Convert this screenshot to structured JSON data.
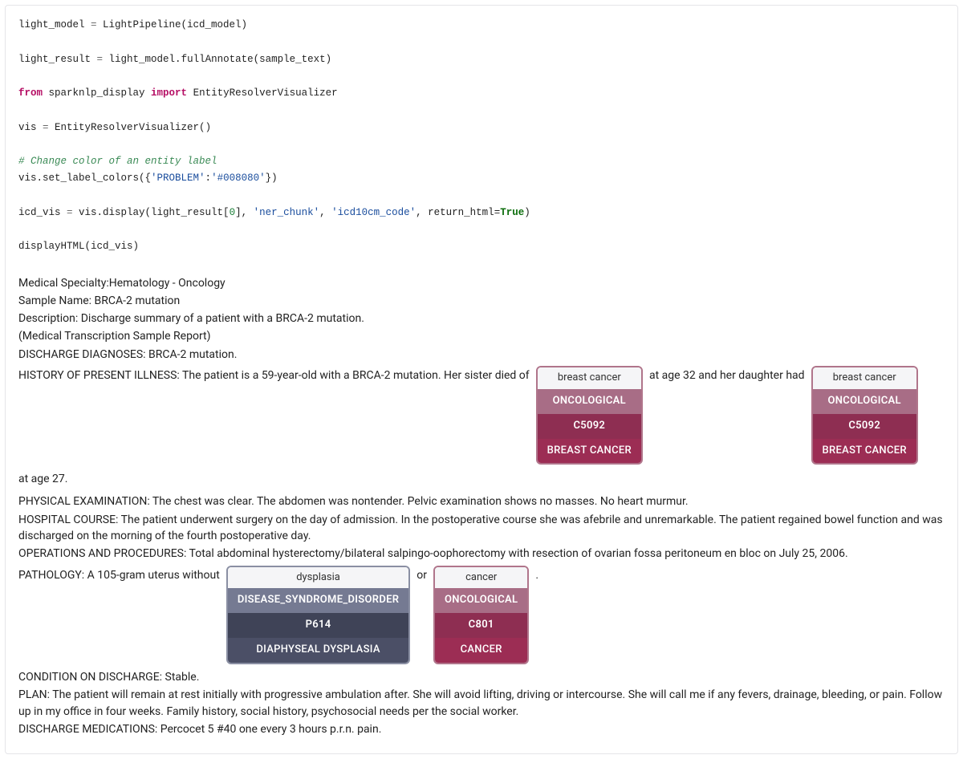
{
  "code": {
    "l1a": "light_model ",
    "l1b": "=",
    "l1c": " LightPipeline(icd_model)",
    "l2a": "light_result ",
    "l2b": "=",
    "l2c": " light_model.fullAnnotate(sample_text)",
    "l3a": "from",
    "l3b": " sparknlp_display ",
    "l3c": "import",
    "l3d": " EntityResolverVisualizer",
    "l4a": "vis ",
    "l4b": "=",
    "l4c": " EntityResolverVisualizer()",
    "l5": "# Change color of an entity label",
    "l6a": "vis.set_label_colors({",
    "l6b": "'PROBLEM'",
    "l6c": ":",
    "l6d": "'#008080'",
    "l6e": "})",
    "l7a": "icd_vis ",
    "l7b": "=",
    "l7c": " vis.display(light_result[",
    "l7d": "0",
    "l7e": "], ",
    "l7f": "'ner_chunk'",
    "l7g": ", ",
    "l7h": "'icd10cm_code'",
    "l7i": ", return_html=",
    "l7j": "True",
    "l7k": ")",
    "l8": "displayHTML(icd_vis)"
  },
  "doc": {
    "meta": [
      "Medical Specialty:Hematology - Oncology",
      "Sample Name: BRCA-2 mutation",
      "Description: Discharge summary of a patient with a BRCA-2 mutation.",
      "(Medical Transcription Sample Report)",
      "DISCHARGE DIAGNOSES: BRCA-2 mutation."
    ],
    "history_pre": "HISTORY OF PRESENT ILLNESS: The patient is a 59-year-old with a BRCA-2 mutation. Her sister died of",
    "history_mid": "at age 32 and her daughter had",
    "history_post": "at age 27.",
    "ent_bc": {
      "text": "breast cancer",
      "label": "ONCOLOGICAL",
      "code": "C5092",
      "res": "BREAST CANCER"
    },
    "pe": "PHYSICAL EXAMINATION: The chest was clear. The abdomen was nontender. Pelvic examination shows no masses. No heart murmur.",
    "hc": "HOSPITAL COURSE: The patient underwent surgery on the day of admission. In the postoperative course she was afebrile and unremarkable. The patient regained bowel function and was discharged on the morning of the fourth postoperative day.",
    "op": "OPERATIONS AND PROCEDURES: Total abdominal hysterectomy/bilateral salpingo-oophorectomy with resection of ovarian fossa peritoneum en bloc on July 25, 2006.",
    "path_pre": "PATHOLOGY: A 105-gram uterus without",
    "path_mid": "or",
    "path_post": ".",
    "ent_dysplasia": {
      "text": "dysplasia",
      "label": "DISEASE_SYNDROME_DISORDER",
      "code": "P614",
      "res": "DIAPHYSEAL DYSPLASIA"
    },
    "ent_cancer": {
      "text": "cancer",
      "label": "ONCOLOGICAL",
      "code": "C801",
      "res": "CANCER"
    },
    "cond": "CONDITION ON DISCHARGE: Stable.",
    "plan": "PLAN: The patient will remain at rest initially with progressive ambulation after. She will avoid lifting, driving or intercourse. She will call me if any fevers, drainage, bleeding, or pain. Follow up in my office in four weeks. Family history, social history, psychosocial needs per the social worker.",
    "meds": "DISCHARGE MEDICATIONS: Percocet 5 #40 one every 3 hours p.r.n. pain."
  }
}
